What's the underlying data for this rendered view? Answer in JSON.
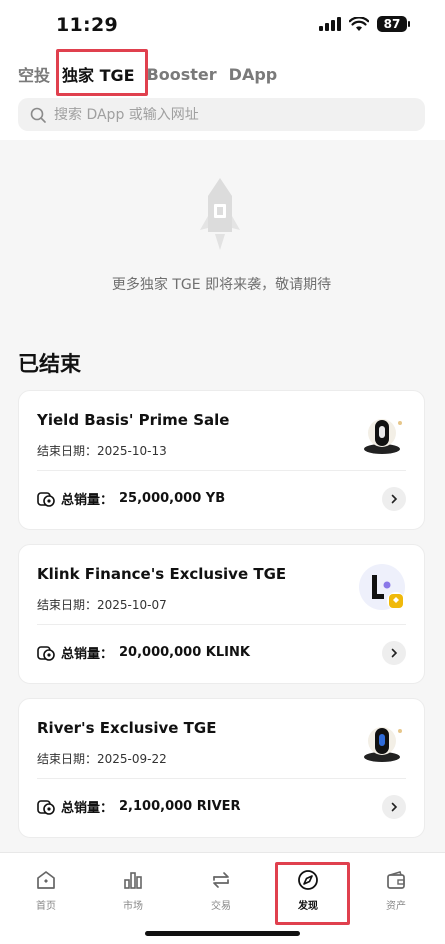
{
  "status_bar": {
    "time": "11:29",
    "battery": "87"
  },
  "tabs": [
    {
      "label": "空投",
      "active": false
    },
    {
      "label": "独家 TGE",
      "active": true
    },
    {
      "label": "Booster",
      "active": false
    },
    {
      "label": "DApp",
      "active": false
    }
  ],
  "search": {
    "placeholder": "搜索 DApp 或输入网址"
  },
  "empty_state": {
    "message": "更多独家 TGE 即将来袭，敬请期待"
  },
  "section": {
    "title": "已结束"
  },
  "cards": [
    {
      "title": "Yield Basis' Prime Sale",
      "date_label": "结束日期：",
      "date": "2025-10-13",
      "sales_label": "总销量：",
      "sales_value": "25,000,000 YB"
    },
    {
      "title": "Klink Finance's Exclusive TGE",
      "date_label": "结束日期：",
      "date": "2025-10-07",
      "sales_label": "总销量：",
      "sales_value": "20,000,000 KLINK"
    },
    {
      "title": "River's Exclusive TGE",
      "date_label": "结束日期：",
      "date": "2025-09-22",
      "sales_label": "总销量：",
      "sales_value": "2,100,000 RIVER"
    }
  ],
  "bottom_nav": [
    {
      "label": "首页",
      "icon": "home-icon",
      "active": false
    },
    {
      "label": "市场",
      "icon": "market-chart-icon",
      "active": false
    },
    {
      "label": "交易",
      "icon": "trade-swap-icon",
      "active": false
    },
    {
      "label": "发现",
      "icon": "discover-compass-icon",
      "active": true
    },
    {
      "label": "资产",
      "icon": "wallet-icon",
      "active": false
    }
  ],
  "colors": {
    "highlight": "#e0404e",
    "background": "#f6f6f6",
    "card": "#ffffff",
    "text": "#111111",
    "muted": "#7a7a7a"
  }
}
